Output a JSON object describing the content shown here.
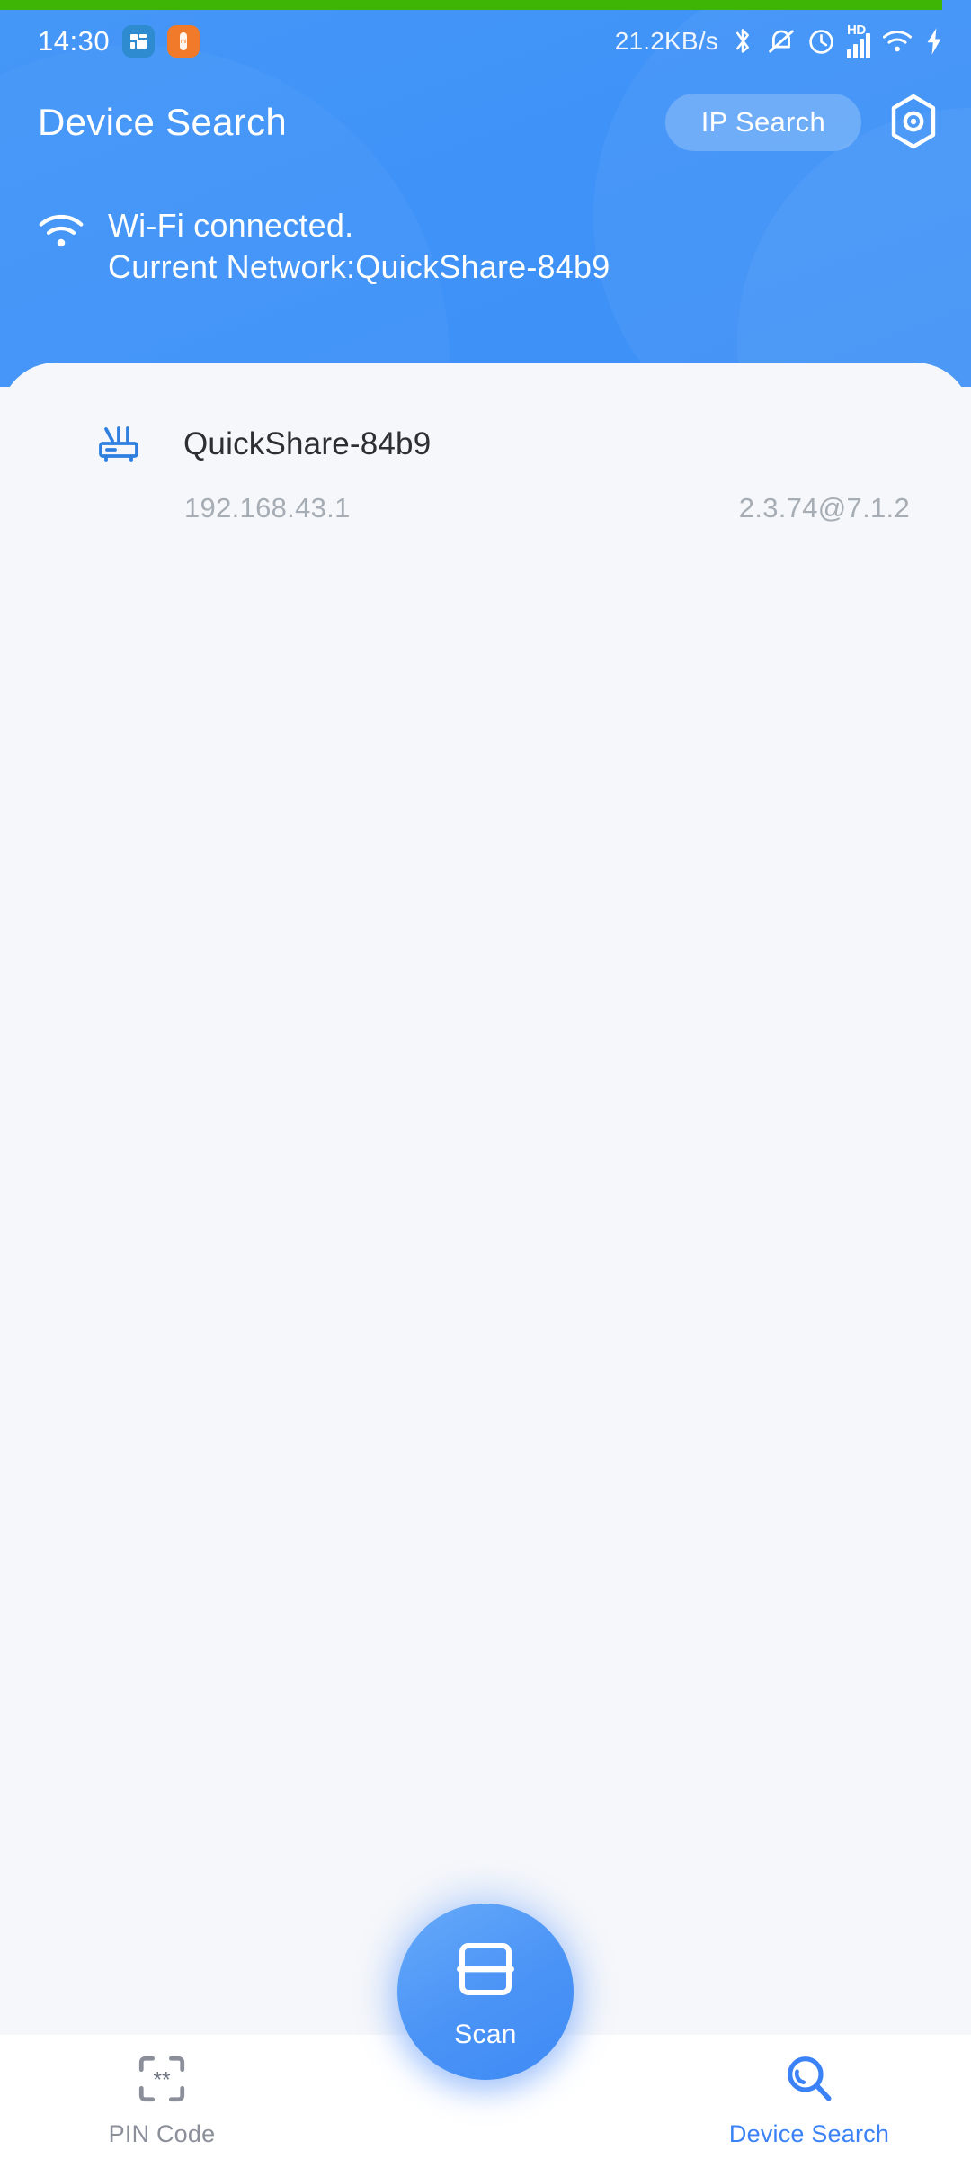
{
  "status_bar": {
    "time": "14:30",
    "network_speed": "21.2KB/s",
    "icons": [
      "app-badge-blue",
      "app-badge-orange",
      "bluetooth-icon",
      "silent-mode-icon",
      "alarm-clock-icon",
      "hd-signal-icon",
      "wifi-icon",
      "charging-bolt-icon"
    ],
    "hd_label": "HD"
  },
  "header": {
    "title": "Device Search",
    "ip_search_label": "IP Search",
    "settings_icon": "hexagon-settings-icon",
    "wifi_icon": "wifi-icon",
    "wifi_status_line1": "Wi-Fi connected.",
    "wifi_status_line2": "Current Network:QuickShare-84b9"
  },
  "devices": [
    {
      "icon": "router-icon",
      "name": "QuickShare-84b9",
      "ip": "192.168.43.1",
      "version": "2.3.74@7.1.2"
    }
  ],
  "bottom_nav": {
    "pin_code_label": "PIN Code",
    "pin_code_icon": "pin-code-scan-frame-icon",
    "scan_label": "Scan",
    "scan_icon": "scan-frame-icon",
    "device_search_label": "Device Search",
    "device_search_icon": "magnifier-icon"
  },
  "colors": {
    "header_blue": "#4190F7",
    "accent_blue": "#3B82F6",
    "progress_green": "#3EB504",
    "page_bg": "#F5F7FA",
    "nav_bg": "#FFFFFF",
    "muted_text": "#A7ADB5",
    "inactive_nav": "#8A8F99"
  }
}
